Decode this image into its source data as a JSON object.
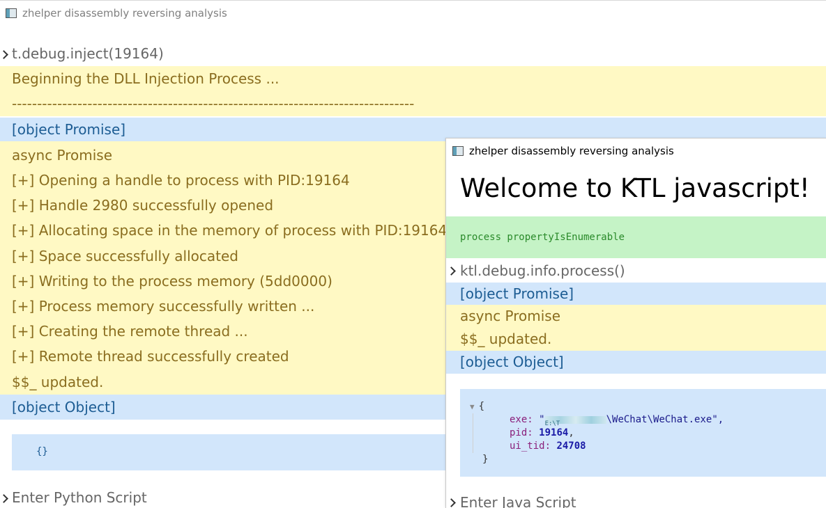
{
  "win1": {
    "title": "zhelper disassembly reversing analysis",
    "command": "t.debug.inject(19164)",
    "block1": [
      "Beginning the DLL Injection Process ...",
      "--------------------------------------------------------------------------------"
    ],
    "promise": "[object Promise]",
    "log": [
      "async Promise",
      "[+] Opening a handle to process with PID:19164",
      "[+] Handle 2980 successfully opened",
      "[+] Allocating space in the memory of process with PID:19164",
      "[+] Space successfully allocated",
      "[+] Writing to the process memory (5dd0000)",
      "[+] Process memory successfully written ...",
      "[+] Creating the remote thread ...",
      "[+] Remote thread successfully created",
      "$$_ updated."
    ],
    "object": "[object Object]",
    "result": "{}",
    "input_placeholder": "Enter Python Script"
  },
  "win2": {
    "title": "zhelper disassembly reversing analysis",
    "welcome": "Welcome to KTL javascript!",
    "props": "process propertyIsEnumerable",
    "command": "ktl.debug.info.process()",
    "promise": "[object Promise]",
    "log": [
      "async Promise",
      "$$_ updated."
    ],
    "object": "[object Object]",
    "json": {
      "open": "{",
      "exe_key": "exe:",
      "exe_q1": "\"",
      "exe_prefix": "E:\\T",
      "exe_value": "\\WeChat\\WeChat.exe",
      "exe_q2": "\",",
      "pid_key": "pid:",
      "pid_value": "19164",
      "pid_comma": ",",
      "tid_key": "ui_tid:",
      "tid_value": "24708",
      "close": "}"
    },
    "input_placeholder": "Enter Java Script"
  }
}
